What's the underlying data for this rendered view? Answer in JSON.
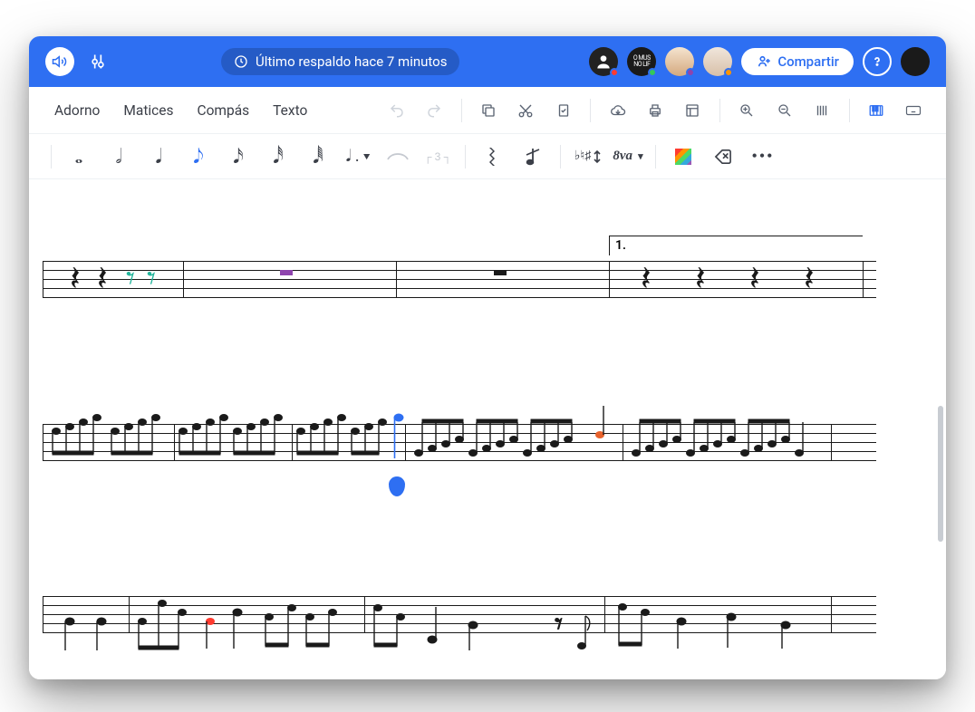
{
  "topbar": {
    "backup_label": "Último respaldo hace 7 minutos",
    "share_label": "Compartir"
  },
  "collaborators": [
    {
      "bg": "#222",
      "presence": "#ff3b30"
    },
    {
      "bg": "#111",
      "presence": "#34c759",
      "text": "O MUS"
    },
    {
      "bg": "#d9b089",
      "presence": "#8e44ad"
    },
    {
      "bg": "#e8d6c4",
      "presence": "#ff9500"
    }
  ],
  "menu": {
    "items": [
      "Adorno",
      "Matices",
      "Compás",
      "Texto"
    ]
  },
  "notebar": {
    "octave_label": "8va",
    "accidental_label": "♭♮♯",
    "triplet_label": "┌ 3 ┐"
  },
  "score": {
    "volta_1": "1."
  }
}
